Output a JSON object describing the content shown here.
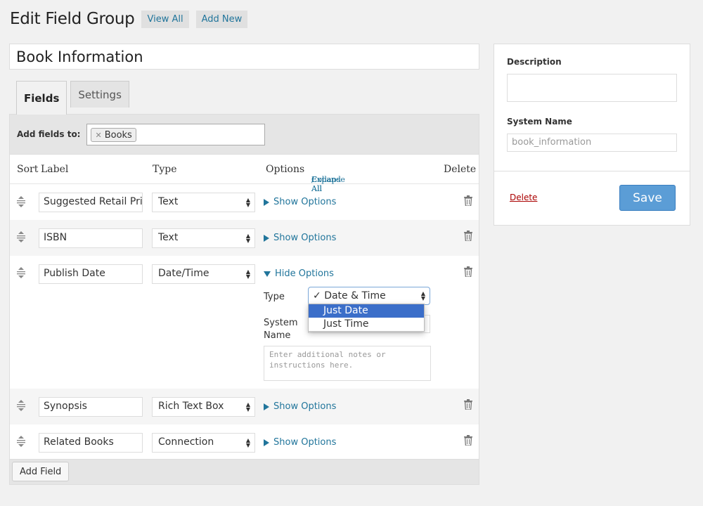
{
  "header": {
    "title": "Edit Field Group",
    "view_all": "View All",
    "add_new": "Add New"
  },
  "group_title": "Book Information",
  "tabs": [
    {
      "label": "Fields",
      "active": true
    },
    {
      "label": "Settings",
      "active": false
    }
  ],
  "add_fields_to": {
    "label": "Add fields to:",
    "tokens": [
      "Books"
    ]
  },
  "columns": {
    "sort": "Sort",
    "label": "Label",
    "type": "Type",
    "options": "Options",
    "expand_all": "Expand All",
    "separator": "/",
    "collapse_all": "Collapse All",
    "delete": "Delete"
  },
  "fields": [
    {
      "label": "Suggested Retail Pric",
      "type": "Text",
      "options_link": "Show Options"
    },
    {
      "label": "ISBN",
      "type": "Text",
      "options_link": "Show Options"
    },
    {
      "label": "Publish Date",
      "type": "Date/Time",
      "options_link": "Hide Options"
    },
    {
      "label": "Synopsis",
      "type": "Rich Text Box",
      "options_link": "Show Options"
    },
    {
      "label": "Related Books",
      "type": "Connection",
      "options_link": "Show Options"
    }
  ],
  "date_options": {
    "type_label": "Type",
    "selected": "Date & Time",
    "checkmark": "✓",
    "dropdown_items": [
      "Just Date",
      "Just Time"
    ],
    "highlighted": "Just Date",
    "system_name_label_1": "System",
    "system_name_label_2": "Name",
    "notes_placeholder": "Enter additional notes or instructions here."
  },
  "footer": {
    "add_field": "Add Field"
  },
  "sidebar": {
    "description_label": "Description",
    "system_name_label": "System Name",
    "system_name_value": "book_information",
    "delete": "Delete",
    "save": "Save"
  },
  "colors": {
    "link": "#21759b",
    "save": "#5b9dd6",
    "highlight": "#3b6ec9",
    "delete": "#aa0000"
  }
}
